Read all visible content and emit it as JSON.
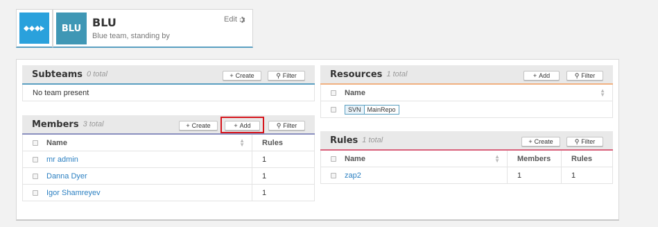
{
  "team": {
    "abbr": "BLU",
    "name": "BLU",
    "description": "Blue team, standing by",
    "edit_label": "Edit"
  },
  "subteams": {
    "title": "Subteams",
    "count": "0 total",
    "create_label": "Create",
    "filter_label": "Filter",
    "empty_text": "No team present"
  },
  "members": {
    "title": "Members",
    "count": "3 total",
    "create_label": "Create",
    "add_label": "Add",
    "filter_label": "Filter",
    "columns": [
      "Name",
      "Rules"
    ],
    "rows": [
      {
        "name": "mr admin",
        "rules": "1"
      },
      {
        "name": "Danna Dyer",
        "rules": "1"
      },
      {
        "name": "Igor Shamreyev",
        "rules": "1"
      }
    ]
  },
  "resources": {
    "title": "Resources",
    "count": "1 total",
    "add_label": "Add",
    "filter_label": "Filter",
    "columns": [
      "Name"
    ],
    "rows": [
      {
        "type": "SVN",
        "name": "MainRepo"
      }
    ]
  },
  "rules": {
    "title": "Rules",
    "count": "1 total",
    "create_label": "Create",
    "filter_label": "Filter",
    "columns": [
      "Name",
      "Members",
      "Rules"
    ],
    "rows": [
      {
        "name": "zap2",
        "members": "1",
        "rules": "1"
      }
    ]
  },
  "colors": {
    "accent": "#2aa1dc",
    "team_tile": "#3f97b5",
    "highlight": "#d6141b",
    "subteams_bar": "#5a9fc1",
    "members_bar": "#8a8fbf",
    "resources_bar": "#f0b080",
    "rules_bar": "#d9607a"
  }
}
